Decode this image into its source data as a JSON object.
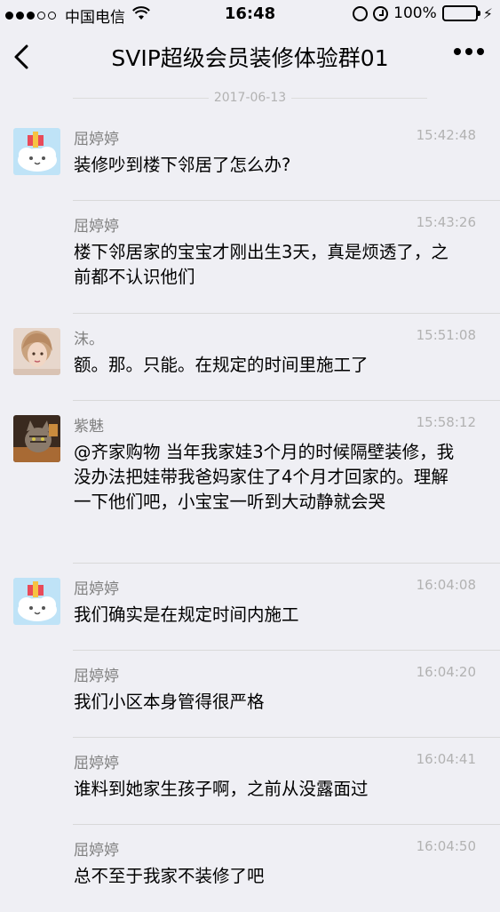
{
  "status_bar": {
    "carrier": "中国电信",
    "time": "16:48",
    "battery": "100%",
    "signal_bars_filled": 3,
    "signal_bars_total": 5,
    "battery_level": 1.0
  },
  "nav": {
    "title": "SVIP超级会员装修体验群01"
  },
  "date_divider": "2017-06-13",
  "messages": [
    {
      "sender": "屈婷婷",
      "time": "15:42:48",
      "text": "装修吵到楼下邻居了怎么办?",
      "avatar": "cartoon-avatar"
    },
    {
      "sender": "屈婷婷",
      "time": "15:43:26",
      "text": "楼下邻居家的宝宝才刚出生3天，真是烦透了，之前都不认识他们",
      "avatar": ""
    },
    {
      "sender": "沫。",
      "time": "15:51:08",
      "text": "额。那。只能。在规定的时间里施工了",
      "avatar": "photo-avatar-girl"
    },
    {
      "sender": "紫魅",
      "time": "15:58:12",
      "text": "@齐家购物 当年我家娃3个月的时候隔壁装修，我没办法把娃带我爸妈家住了4个月才回家的。理解一下他们吧，小宝宝一听到大动静就会哭",
      "avatar": "photo-avatar-cat"
    },
    {
      "sender": "屈婷婷",
      "time": "16:04:08",
      "text": "我们确实是在规定时间内施工",
      "avatar": "cartoon-avatar"
    },
    {
      "sender": "屈婷婷",
      "time": "16:04:20",
      "text": "我们小区本身管得很严格",
      "avatar": ""
    },
    {
      "sender": "屈婷婷",
      "time": "16:04:41",
      "text": "谁料到她家生孩子啊，之前从没露面过",
      "avatar": ""
    },
    {
      "sender": "屈婷婷",
      "time": "16:04:50",
      "text": "总不至于我家不装修了吧",
      "avatar": ""
    }
  ]
}
